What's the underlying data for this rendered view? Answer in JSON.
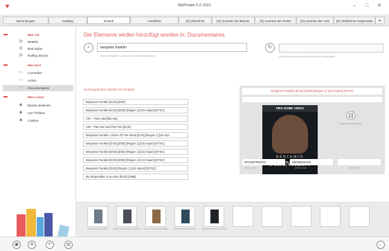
{
  "window": {
    "title": "MyPrivate 5.2.1021",
    "minimize": "–",
    "maximize": "□",
    "close": "✕"
  },
  "tabs": [
    {
      "label": "Sammlungen"
    },
    {
      "label": "Katalog"
    },
    {
      "label": "Erwerb"
    },
    {
      "label": "Cashflow"
    },
    {
      "label": "[G] Übersicht"
    },
    {
      "label": "[G] Inventar der Bücher"
    },
    {
      "label": "[G] Inventar der DVDs"
    },
    {
      "label": "[G] Inventar der CDs"
    },
    {
      "label": "[G] Verliehene Gegenstän"
    }
  ],
  "sidebar": {
    "tree": [
      {
        "label": "Mes Cd"
      },
      {
        "label": "Beatles"
      },
      {
        "label": "Bob Dylan"
      },
      {
        "label": "Rolling Stones"
      },
      {
        "label": "Mes Dvd"
      },
      {
        "label": "Comedies"
      },
      {
        "label": "Action"
      },
      {
        "label": "Documentaires"
      },
      {
        "label": "Mes Livres"
      },
      {
        "label": "Bande dessinée"
      },
      {
        "label": "Les Thrillers"
      },
      {
        "label": "Cuisine"
      }
    ]
  },
  "main": {
    "title": "Die Elemente wirden hinzufügt worden in: Documentaires",
    "search_value": "benjamin franklin",
    "hint_left": "Nach Schlagwort suchen und manuell hinzufügen",
    "hint_right": "Nach Barcode suchen und automatisch hinzufügen",
    "results_label": "Suchergebnisse (klicken für Details)",
    "results": [
      "Benjamin Franklin [DVD] [2007]",
      "Benjamin Franklin [DVD] [2003] [Region 1] [US Import] [NTSC]",
      "Che - Parts 1&2 [Blu-ray]",
      "Che - Part One and Part Two [DVD]",
      "Benjamin Franklin: Citizen Of The World [DVD] [Region 1] [US Imp",
      "Benjamin Franklin [DVD] [2002] [Region 1] [US Import] [NTSC]",
      "Benjamin Franklin [DVD] [2002] [Region 1] [US Import] [NTSC]",
      "Benjamin Franklin [DVD] [2003] [Region 1] [US Import] [NTSC]",
      "Benjamin Franklin [DVD] [Region 1] [US Import] [NTSC]",
      "My Stepmother Is an Alien [DVD] [1988]"
    ]
  },
  "detail": {
    "title": "Benjamin Franklin [DVD] [2003] [Region 1] [US Import] [NTSC]",
    "cover_publisher": "PBS HOME VIDEO",
    "cover_name_1": "BENJAMIN",
    "cover_name_2": "FRANKLIN",
    "add_hint": "Aufführung hinzufügen",
    "codes": [
      {
        "value": "0841887050333",
        "label": "EAN-Code"
      },
      {
        "value": "B000BN4HN6",
        "label": "ASIN-Code"
      },
      {
        "value": "",
        "label": "ISBN-Code"
      }
    ]
  },
  "history": [
    {
      "label": "Sparkle [DVD] [1982]"
    },
    {
      "label": "Martin Luther King Jr [DVD]"
    },
    {
      "label": "Chris Stewart: Manhattan"
    },
    {
      "label": "Elemente: Long Walk to"
    },
    {
      "label": "Benjamin Franklin [DVD]"
    }
  ],
  "colors": {
    "accent": "#e06060",
    "category": "#c94a4a"
  }
}
